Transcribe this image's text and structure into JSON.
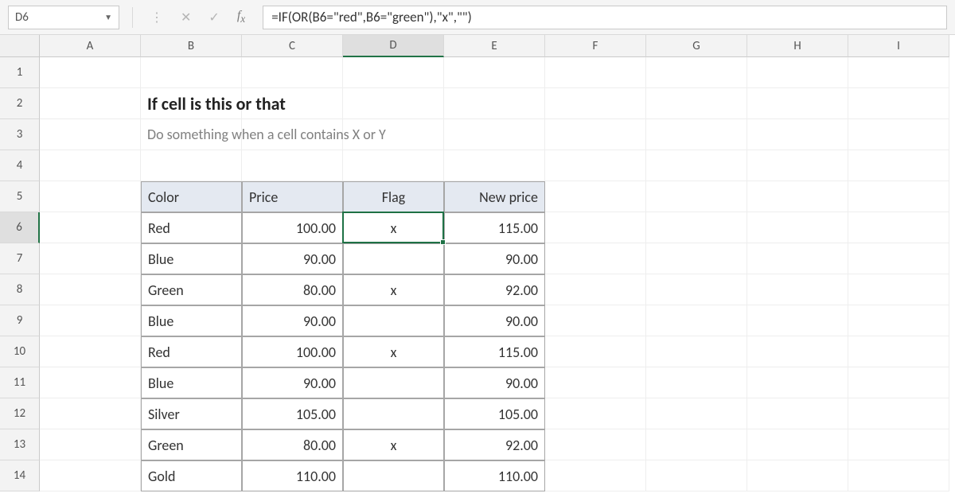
{
  "name_box": "D6",
  "formula": "=IF(OR(B6=\"red\",B6=\"green\"),\"x\",\"\")",
  "columns": [
    "A",
    "B",
    "C",
    "D",
    "E",
    "F",
    "G",
    "H",
    "I"
  ],
  "row_count": 14,
  "active": {
    "col_index": 3,
    "row_index": 5
  },
  "title": "If cell is this or that",
  "subtitle": "Do something when a cell contains X or Y",
  "table": {
    "headers": [
      "Color",
      "Price",
      "Flag",
      "New price"
    ],
    "rows": [
      {
        "color": "Red",
        "price": "100.00",
        "flag": "x",
        "newprice": "115.00"
      },
      {
        "color": "Blue",
        "price": "90.00",
        "flag": "",
        "newprice": "90.00"
      },
      {
        "color": "Green",
        "price": "80.00",
        "flag": "x",
        "newprice": "92.00"
      },
      {
        "color": "Blue",
        "price": "90.00",
        "flag": "",
        "newprice": "90.00"
      },
      {
        "color": "Red",
        "price": "100.00",
        "flag": "x",
        "newprice": "115.00"
      },
      {
        "color": "Blue",
        "price": "90.00",
        "flag": "",
        "newprice": "90.00"
      },
      {
        "color": "Silver",
        "price": "105.00",
        "flag": "",
        "newprice": "105.00"
      },
      {
        "color": "Green",
        "price": "80.00",
        "flag": "x",
        "newprice": "92.00"
      },
      {
        "color": "Gold",
        "price": "110.00",
        "flag": "",
        "newprice": "110.00"
      }
    ]
  },
  "colors": {
    "accent": "#1e7145",
    "header_bg": "#e4e9f1",
    "grid_border": "#a6a6a6"
  }
}
